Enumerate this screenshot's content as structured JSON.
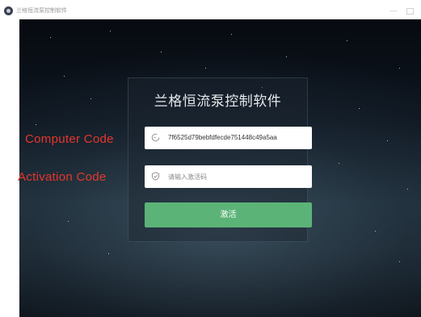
{
  "window": {
    "title": "兰格恒流泵控制软件",
    "minimize_glyph": "—"
  },
  "panel": {
    "title": "兰格恒流泵控制软件"
  },
  "computer_code": {
    "label": "Computer Code",
    "value": "7f6525d79bebfdfecde751448c49a5aa",
    "icon": "refresh-icon"
  },
  "activation_code": {
    "label": "Activation Code",
    "placeholder": "请输入激活码",
    "value": "",
    "icon": "shield-check-icon"
  },
  "activate_button": {
    "label": "激活",
    "color": "#5cb377"
  },
  "colors": {
    "overlay_label": "#e8362b",
    "background_top": "#070a10",
    "background_mid": "#1f2f3a"
  }
}
